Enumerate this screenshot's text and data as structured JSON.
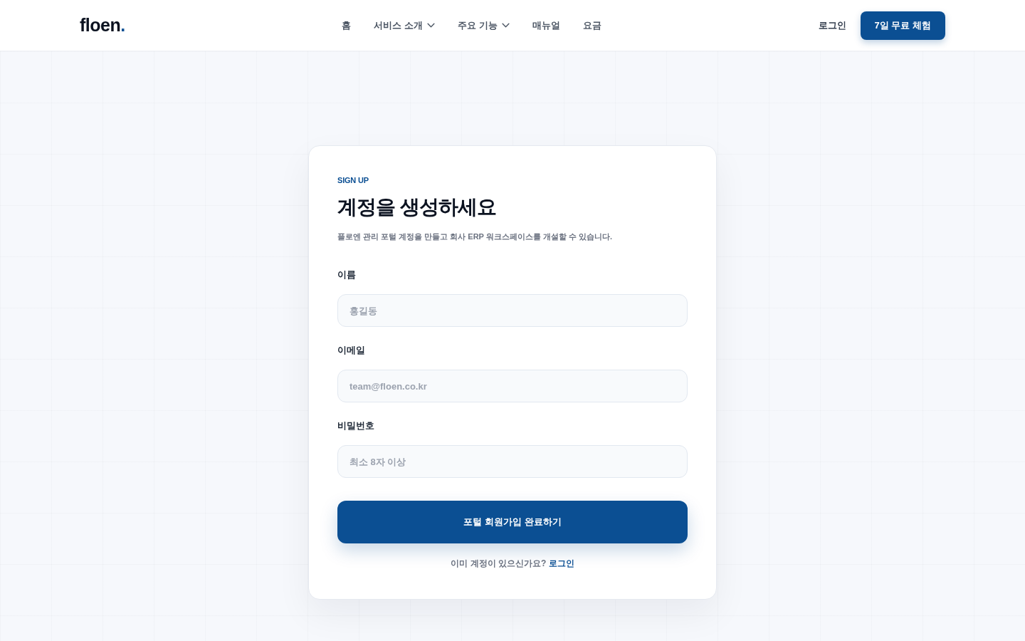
{
  "header": {
    "logo": {
      "name": "floen",
      "dot": "."
    },
    "nav": [
      {
        "label": "홈",
        "has_menu": false
      },
      {
        "label": "서비스 소개",
        "has_menu": true
      },
      {
        "label": "주요 기능",
        "has_menu": true
      },
      {
        "label": "매뉴얼",
        "has_menu": false
      },
      {
        "label": "요금",
        "has_menu": false
      }
    ],
    "login_link": "로그인",
    "trial_button": "7일 무료 체험"
  },
  "signup_card": {
    "eyebrow": "SIGN UP",
    "title": "계정을 생성하세요",
    "description": "플로엔 관리 포털 계정을 만들고 회사 ERP 워크스페이스를 개설할 수 있습니다.",
    "fields": [
      {
        "label": "이름",
        "placeholder": "홍길동"
      },
      {
        "label": "이메일",
        "placeholder": "team@floen.co.kr"
      },
      {
        "label": "비밀번호",
        "placeholder": "최소 8자 이상"
      }
    ],
    "submit_button": "포털 회원가입 완료하기",
    "footer": {
      "text": "이미 계정이 있으신가요?",
      "link": "로그인"
    }
  }
}
